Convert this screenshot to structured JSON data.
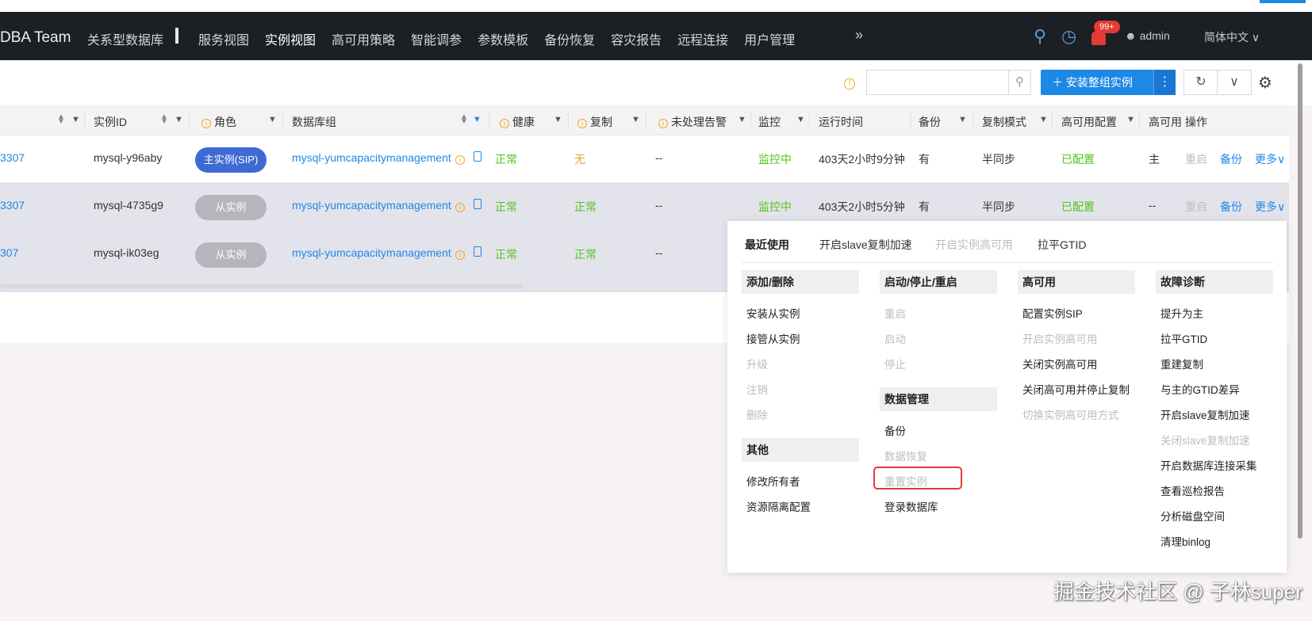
{
  "nav": {
    "brand": "DBA Team",
    "first": "关系型数据库",
    "items": [
      "服务视图",
      "实例视图",
      "高可用策略",
      "智能调参",
      "参数模板",
      "备份恢复",
      "容灾报告",
      "远程连接",
      "用户管理"
    ],
    "more": "»",
    "badge": "99+",
    "user": "admin",
    "lang": "简体中文 ∨"
  },
  "toolbar": {
    "search_placeholder": "",
    "install_label": "安装整组实例",
    "refresh": "↻",
    "collapse": "∨"
  },
  "table": {
    "headers": {
      "id": "实例ID",
      "role": "角色",
      "group": "数据库组",
      "health": "健康",
      "repl": "复制",
      "alarm": "未处理告警",
      "monitor": "监控",
      "uptime": "运行时间",
      "backup": "备份",
      "repl_mode": "复制模式",
      "ha_cfg": "高可用配置",
      "ha": "高可用",
      "ops": "操作"
    },
    "rows": [
      {
        "port": "3307",
        "id": "mysql-y96aby",
        "role": "主实例(SIP)",
        "group": "mysql-yumcapacitymanagement",
        "health": "正常",
        "repl": "无",
        "alarm": "--",
        "monitor": "监控中",
        "uptime": "403天2小时9分钟",
        "backup": "有",
        "repl_mode": "半同步",
        "ha_cfg": "已配置",
        "ha": "主",
        "op_restart": "重启",
        "op_backup": "备份",
        "op_more": "更多∨"
      },
      {
        "port": "3307",
        "id": "mysql-4735g9",
        "role": "从实例",
        "group": "mysql-yumcapacitymanagement",
        "health": "正常",
        "repl": "正常",
        "alarm": "--",
        "monitor": "监控中",
        "uptime": "403天2小时5分钟",
        "backup": "有",
        "repl_mode": "半同步",
        "ha_cfg": "已配置",
        "ha": "--",
        "op_restart": "重启",
        "op_backup": "备份",
        "op_more": "更多∨"
      },
      {
        "port": "307",
        "id": "mysql-ik03eg",
        "role": "从实例",
        "group": "mysql-yumcapacitymanagement",
        "health": "正常",
        "repl": "正常",
        "alarm": "--"
      }
    ]
  },
  "menu": {
    "recent_label": "最近使用",
    "recent": [
      "开启slave复制加速",
      "开启实例高可用",
      "拉平GTID"
    ],
    "sections": {
      "add_remove": {
        "title": "添加/删除",
        "items": [
          "安装从实例",
          "接管从实例",
          "升级",
          "注销",
          "删除"
        ]
      },
      "other": {
        "title": "其他",
        "items": [
          "修改所有者",
          "资源隔离配置"
        ]
      },
      "start_stop": {
        "title": "启动/停止/重启",
        "items": [
          "重启",
          "启动",
          "停止"
        ]
      },
      "data_mgmt": {
        "title": "数据管理",
        "items": [
          "备份",
          "数据恢复",
          "重置实例",
          "登录数据库"
        ]
      },
      "ha": {
        "title": "高可用",
        "items": [
          "配置实例SIP",
          "开启实例高可用",
          "关闭实例高可用",
          "关闭高可用并停止复制",
          "切换实例高可用方式"
        ]
      },
      "diag": {
        "title": "故障诊断",
        "items": [
          "提升为主",
          "拉平GTID",
          "重建复制",
          "与主的GTID差异",
          "开启slave复制加速",
          "关闭slave复制加速",
          "开启数据库连接采集",
          "查看巡检报告",
          "分析磁盘空间",
          "清理binlog"
        ]
      }
    }
  },
  "watermark": "掘金技术社区 @ 子林super"
}
